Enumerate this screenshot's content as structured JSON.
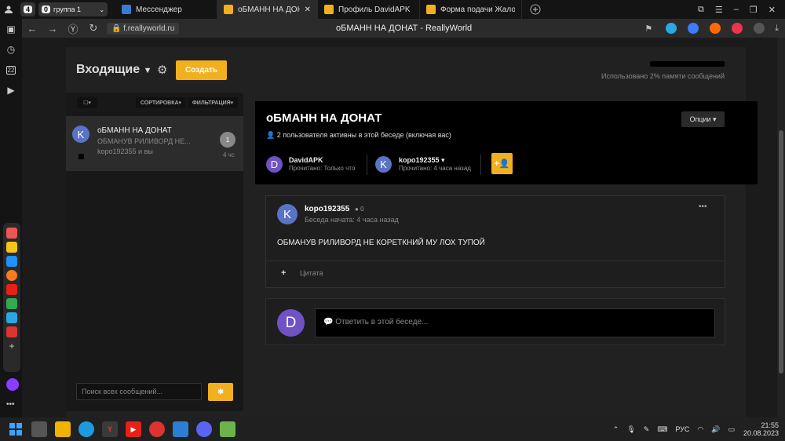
{
  "browser": {
    "group_count": "4",
    "group_badge": "0",
    "group_label": "группа 1",
    "tabs": [
      {
        "label": "Мессенджер",
        "color": "#3a7bd5",
        "active": false
      },
      {
        "label": "оБМАНН НА ДОНАТ - F",
        "color": "#f2b01e",
        "active": true
      },
      {
        "label": "Профиль DavidAPK",
        "color": "#f2b01e",
        "active": false
      },
      {
        "label": "Форма подачи Жалобы н",
        "color": "#f2b01e",
        "active": false
      }
    ],
    "url": "f.reallyworld.ru",
    "page_title": "оБМАНН НА ДОНАТ - ReallyWorld",
    "sidebar_badge": "22"
  },
  "inbox": {
    "title": "Входящие",
    "create_label": "Создать",
    "usage_text": "Использовано 2% памяти сообщений",
    "sort_label": "СОРТИРОВКА",
    "filter_label": "ФИЛЬТРАЦИЯ",
    "search_placeholder": "Поиск всех сообщений..."
  },
  "conversation_item": {
    "avatar_letter": "K",
    "title": "оБМАНН НА ДОНАТ",
    "preview": "ОБМАНУВ  РИЛИВОРД НЕ...",
    "participants": "kopo192355 и вы",
    "count": "1",
    "time": "4 чс"
  },
  "conversation": {
    "title": "оБМАНН НА ДОНАТ",
    "active_users": "2 пользователя активны в этой беседе (включая вас)",
    "options_label": "Опции",
    "participants": [
      {
        "letter": "D",
        "name": "DavidAPK",
        "status": "Прочитано: Только что",
        "color": "#6f52c4"
      },
      {
        "letter": "K",
        "name": "kopo192355",
        "status": "Прочитано: 4 часа назад",
        "color": "#5a73c4"
      }
    ]
  },
  "message": {
    "avatar_letter": "K",
    "author": "kopo192355",
    "reputation": "0",
    "started": "Беседа начата: 4 часа назад",
    "text": "ОБМАНУВ  РИЛИВОРД НЕ КОРЕТКНИЙ  МУ ЛОХ ТУПОЙ",
    "quote_label": "Цитата",
    "more_label": "•••"
  },
  "reply": {
    "avatar_letter": "D",
    "placeholder": "Ответить в этой беседе..."
  },
  "taskbar": {
    "lang": "РУС",
    "time": "21:55",
    "date": "20.08.2023"
  }
}
